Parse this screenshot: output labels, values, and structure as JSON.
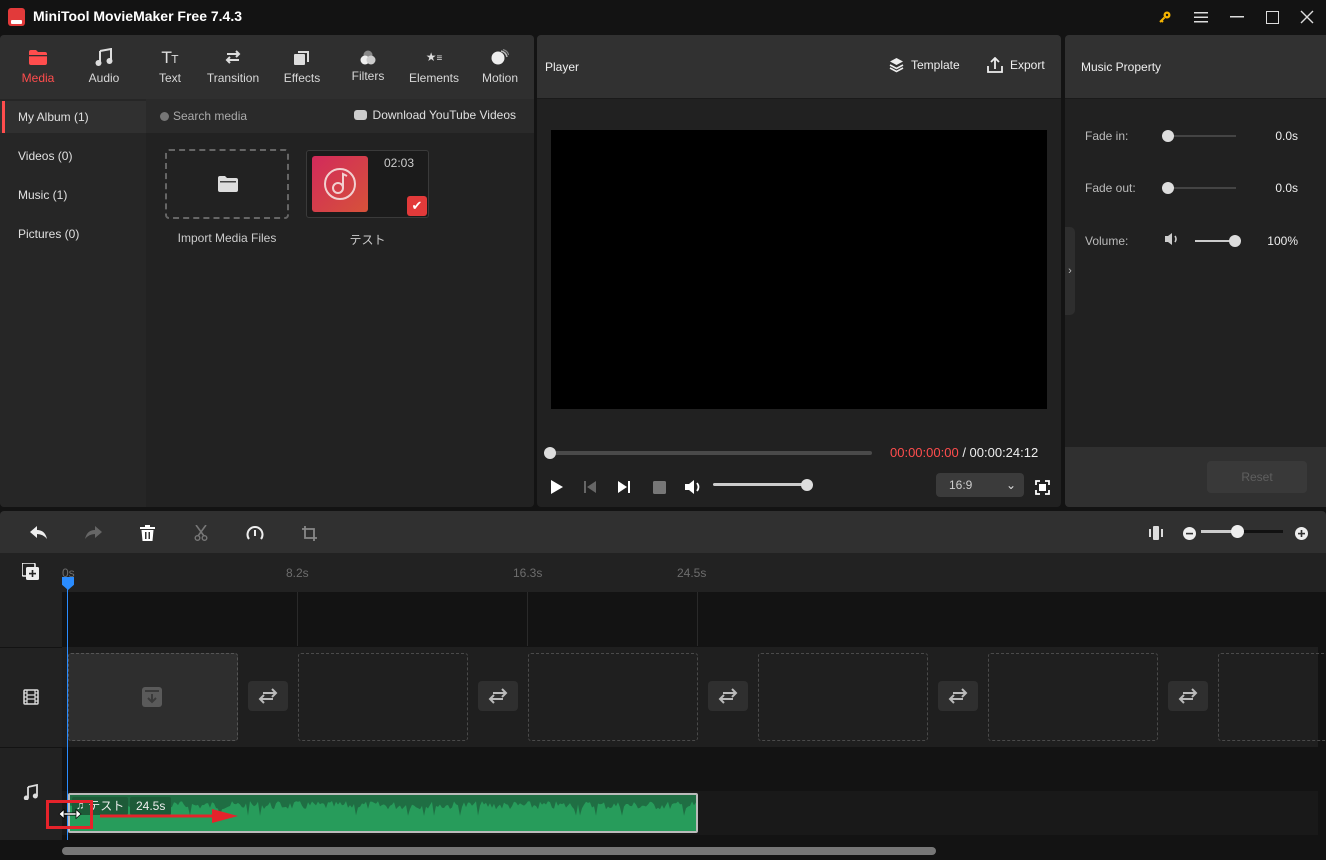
{
  "app": {
    "title": "MiniTool MovieMaker Free 7.4.3"
  },
  "window_controls": [
    {
      "name": "key-icon",
      "glyph": "🔑"
    },
    {
      "name": "menu-icon",
      "glyph": "☰"
    },
    {
      "name": "minimize-icon",
      "glyph": "—"
    },
    {
      "name": "maximize-icon",
      "glyph": "☐"
    },
    {
      "name": "close-icon",
      "glyph": "✕"
    }
  ],
  "tabs": [
    {
      "label": "Media",
      "icon": "folder-icon",
      "active": true
    },
    {
      "label": "Audio",
      "icon": "music-icon"
    },
    {
      "label": "Text",
      "icon": "text-icon"
    },
    {
      "label": "Transition",
      "icon": "transition-icon"
    },
    {
      "label": "Effects",
      "icon": "effects-icon"
    },
    {
      "label": "Filters",
      "icon": "filters-icon"
    },
    {
      "label": "Elements",
      "icon": "elements-icon"
    },
    {
      "label": "Motion",
      "icon": "motion-icon"
    }
  ],
  "album": {
    "items": [
      {
        "label": "My Album (1)",
        "active": true
      },
      {
        "label": "Videos (0)"
      },
      {
        "label": "Music (1)"
      },
      {
        "label": "Pictures (0)"
      }
    ]
  },
  "media": {
    "search_placeholder": "Search media",
    "download_label": "Download YouTube Videos",
    "import_label": "Import Media Files",
    "files": [
      {
        "name": "テスト",
        "duration": "02:03",
        "selected": true
      }
    ]
  },
  "player": {
    "title": "Player",
    "template_label": "Template",
    "export_label": "Export",
    "current_time": "00:00:00:00",
    "total_time": "/ 00:00:24:12",
    "progress": 0,
    "volume_percent": 100,
    "aspect_ratio": "16:9"
  },
  "property": {
    "title": "Music Property",
    "fade_in_label": "Fade in:",
    "fade_in_value": "0.0s",
    "fade_out_label": "Fade out:",
    "fade_out_value": "0.0s",
    "volume_label": "Volume:",
    "volume_value": "100%",
    "volume_percent": 100,
    "reset_label": "Reset"
  },
  "timeline": {
    "ruler_ticks": [
      "0s",
      "8.2s",
      "16.3s",
      "24.5s"
    ],
    "audio_clip": {
      "name": "テスト",
      "length": "24.5s"
    },
    "zoom_level_fraction": 0.45
  },
  "colors": {
    "accent": "#ff4d4d",
    "playhead": "#2a8cff",
    "audio_clip": "#279c5b",
    "annotation": "#e5232b"
  }
}
